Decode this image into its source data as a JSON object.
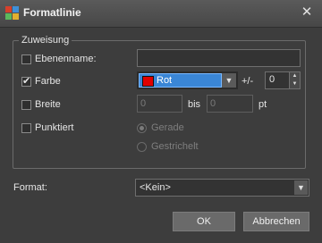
{
  "window": {
    "title": "Formatlinie",
    "icon": "app-grid-icon",
    "close_glyph": "✕"
  },
  "group": {
    "legend": "Zuweisung",
    "layer_name": {
      "label": "Ebenenname:",
      "checked": false,
      "value": ""
    },
    "color": {
      "label": "Farbe",
      "checked": true,
      "selected": "Rot",
      "swatch_color": "#e00000",
      "tolerance_label": "+/-",
      "tolerance_value": "0"
    },
    "width": {
      "label": "Breite",
      "checked": false,
      "from_value": "0",
      "to_label": "bis",
      "to_value": "0",
      "unit": "pt"
    },
    "dotted": {
      "label": "Punktiert",
      "checked": false,
      "options": [
        {
          "label": "Gerade",
          "selected": true
        },
        {
          "label": "Gestrichelt",
          "selected": false
        }
      ]
    }
  },
  "format": {
    "label": "Format:",
    "selected": "<Kein>"
  },
  "buttons": {
    "ok": "OK",
    "cancel": "Abbrechen"
  },
  "colors": {
    "accent": "#3a86d6",
    "background": "#3d3d3d"
  }
}
